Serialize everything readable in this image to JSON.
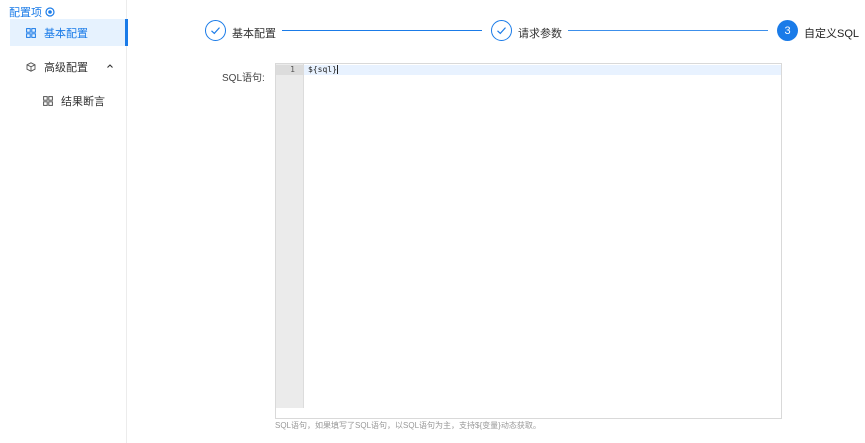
{
  "sidebar": {
    "header": "配置项",
    "header_icon": "target-icon",
    "items": [
      {
        "label": "基本配置",
        "icon": "grid-icon",
        "active": true
      },
      {
        "label": "高级配置",
        "icon": "cube-icon",
        "expanded": true
      },
      {
        "label": "结果断言",
        "icon": "grid-icon"
      }
    ]
  },
  "steps": [
    {
      "label": "基本配置",
      "status": "done"
    },
    {
      "label": "请求参数",
      "status": "done"
    },
    {
      "label": "自定义SQL",
      "number": "3",
      "status": "current"
    }
  ],
  "form": {
    "sql_label": "SQL语句:",
    "editor": {
      "line_number": "1",
      "code": "${sql}"
    },
    "hint": "SQL语句，如果填写了SQL语句，以SQL语句为主，支持${变量}动态获取。"
  },
  "colors": {
    "accent": "#1a7be8",
    "active_bg": "#e6f2fe"
  }
}
